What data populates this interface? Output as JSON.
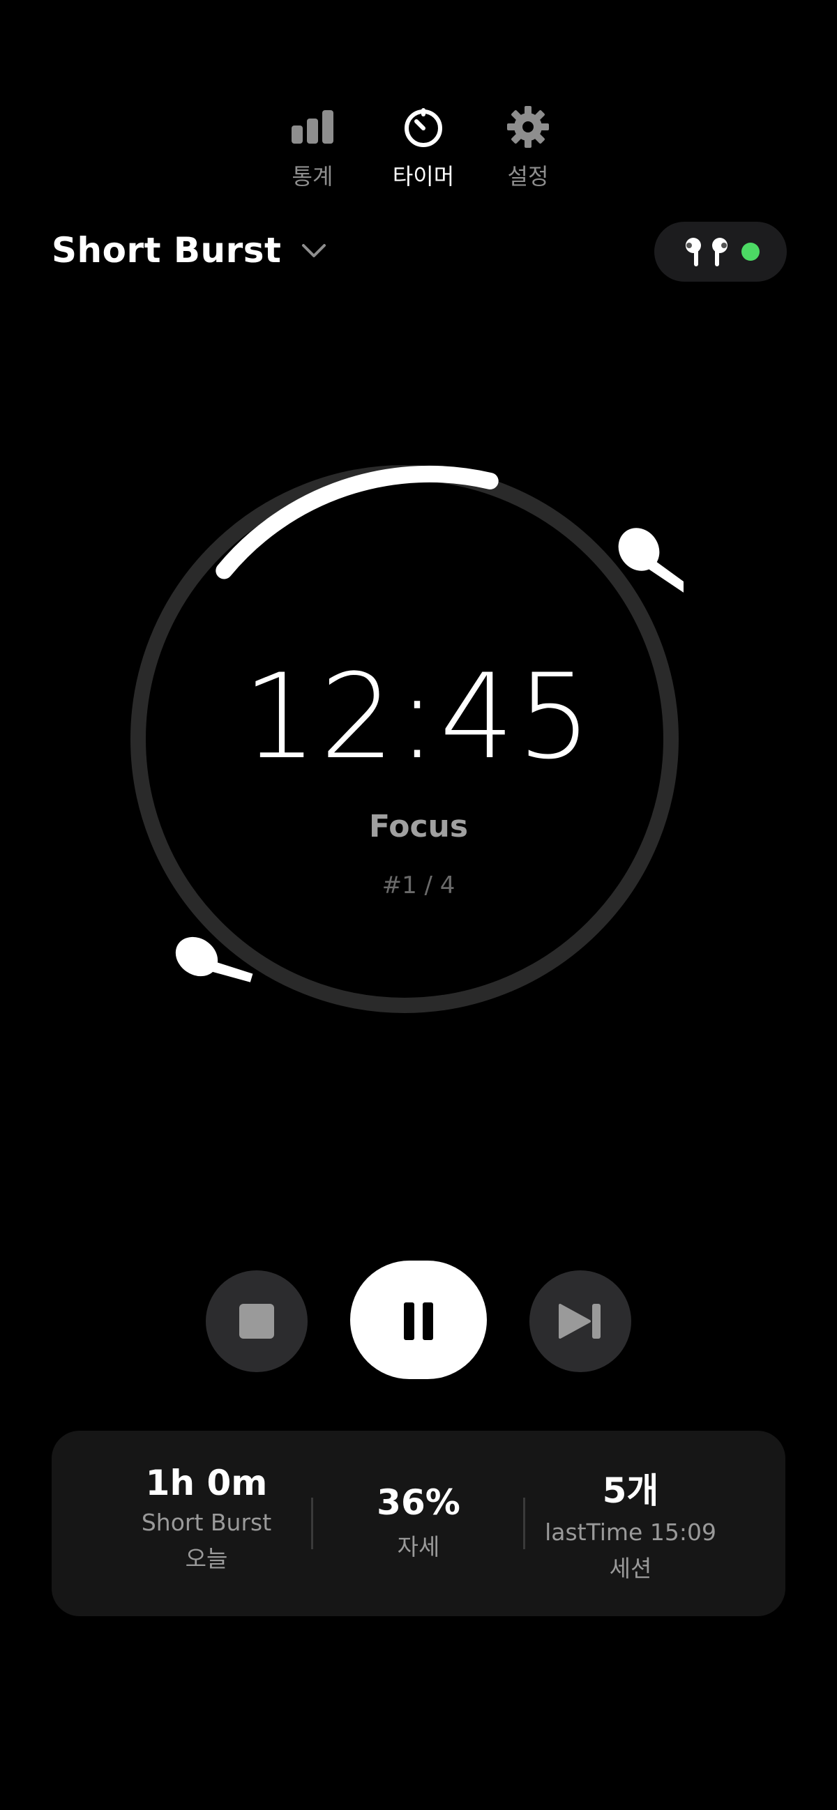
{
  "nav": {
    "stats_label": "통계",
    "timer_label": "타이머",
    "settings_label": "설정",
    "active": "timer"
  },
  "preset": {
    "name": "Short Burst"
  },
  "device": {
    "icon": "earbuds-icon",
    "connected": true,
    "status_color": "#4cd964"
  },
  "timer": {
    "time": "12:45",
    "phase": "Focus",
    "session": "#1 / 4"
  },
  "controls": {
    "stop_icon": "stop-icon",
    "pause_icon": "pause-icon",
    "skip_icon": "skip-forward-icon"
  },
  "stats": {
    "today_total": "1h 0m",
    "today_preset": "Short Burst",
    "today_label": "오늘",
    "posture_value": "36%",
    "posture_label": "자세",
    "sessions_value": "5개",
    "sessions_last": "lastTime 15:09",
    "sessions_label": "세션"
  },
  "colors": {
    "background": "#000000",
    "ring_track": "#2a2a2a",
    "ring_progress": "#ffffff",
    "card": "#161616"
  }
}
